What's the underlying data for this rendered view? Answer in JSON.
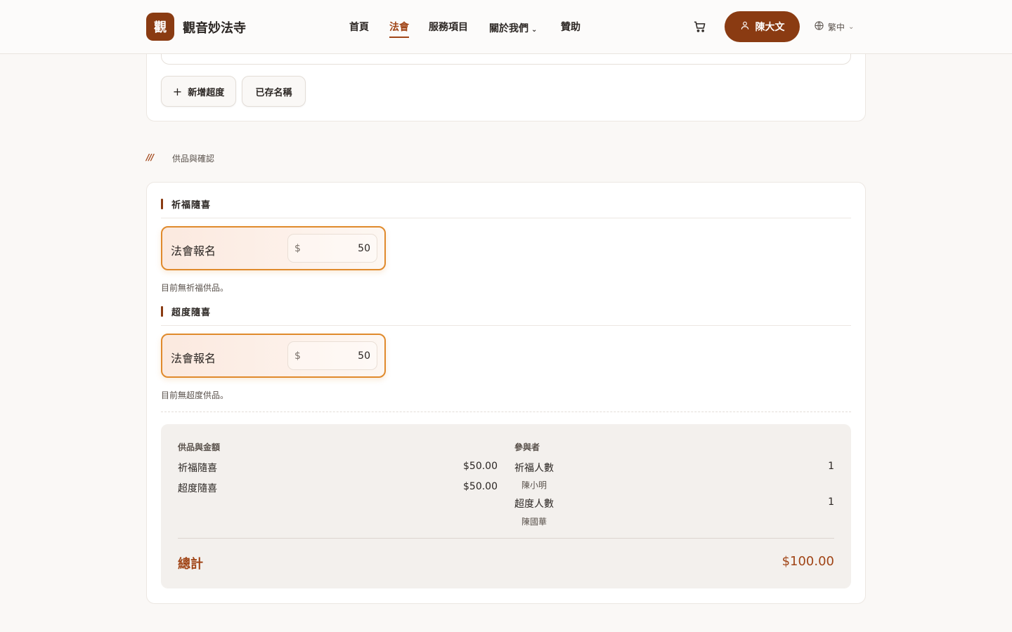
{
  "header": {
    "logo_char": "觀",
    "site_name": "觀音妙法寺",
    "nav": [
      "首頁",
      "法會",
      "服務項目",
      "關於我們",
      "贊助"
    ],
    "user_name": "陳大文",
    "lang": "繁中"
  },
  "top_card": {
    "add_btn": "新增超度",
    "saved_btn": "已存名稱"
  },
  "section": {
    "marker": "///",
    "title": "供品與確認"
  },
  "groups": [
    {
      "title": "祈福隨喜",
      "item_name": "法會報名",
      "currency": "$",
      "amount": "50",
      "empty_note": "目前無祈福供品。"
    },
    {
      "title": "超度隨喜",
      "item_name": "法會報名",
      "currency": "$",
      "amount": "50",
      "empty_note": "目前無超度供品。"
    }
  ],
  "summary": {
    "left_label": "供品與金額",
    "right_label": "參與者",
    "lines": [
      {
        "name": "祈福隨喜",
        "amount": "$50.00"
      },
      {
        "name": "超度隨喜",
        "amount": "$50.00"
      }
    ],
    "participants": [
      {
        "label": "祈福人數",
        "count": "1",
        "name": "陳小明"
      },
      {
        "label": "超度人數",
        "count": "1",
        "name": "陳國華"
      }
    ],
    "total_label": "總計",
    "total_value": "$100.00"
  }
}
